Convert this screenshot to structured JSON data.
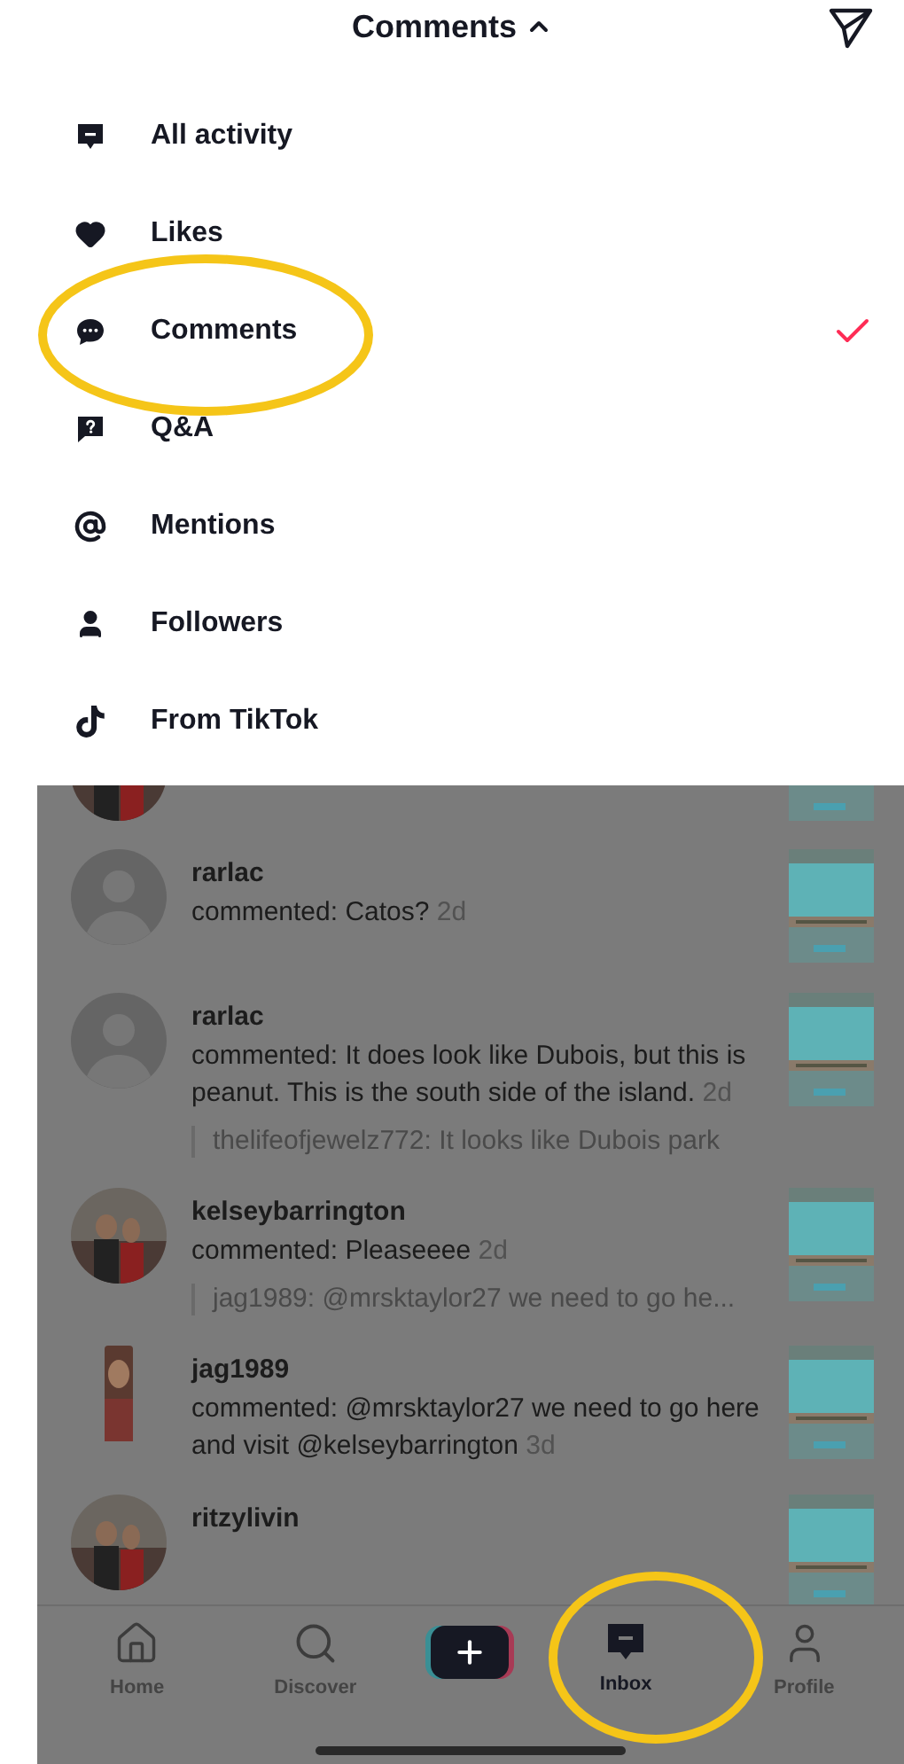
{
  "header": {
    "title": "Comments",
    "expanded": true
  },
  "menu": [
    {
      "kind": "activity",
      "label": "All activity",
      "selected": false
    },
    {
      "kind": "likes",
      "label": "Likes",
      "selected": false
    },
    {
      "kind": "comments",
      "label": "Comments",
      "selected": true
    },
    {
      "kind": "qa",
      "label": "Q&A",
      "selected": false
    },
    {
      "kind": "mentions",
      "label": "Mentions",
      "selected": false
    },
    {
      "kind": "followers",
      "label": "Followers",
      "selected": false
    },
    {
      "kind": "tiktok",
      "label": "From TikTok",
      "selected": false
    }
  ],
  "notifications": [
    {
      "username": "rarlac",
      "avatar": {
        "kind": "default"
      },
      "comment": "commented: Catos?",
      "time": "2d"
    },
    {
      "username": "rarlac",
      "avatar": {
        "kind": "default"
      },
      "comment": "commented: It does look like Dubois, but this is peanut. This is the south side of the island.",
      "time": "2d",
      "quote": "thelifeofjewelz772: It looks like Dubois park"
    },
    {
      "username": "kelseybarrington",
      "comment": "commented: Pleaseeee",
      "time": "2d",
      "quote": "jag1989: @mrsktaylor27 we need to go he..."
    },
    {
      "username": "jag1989",
      "avatar": {
        "kind": "portrait"
      },
      "comment": "commented: @mrsktaylor27 we need to go here and visit @kelseybarrington",
      "time": "3d"
    },
    {
      "username": "ritzylivin"
    }
  ],
  "tabs": [
    {
      "kind": "home",
      "label": "Home",
      "selected": false
    },
    {
      "kind": "discover",
      "label": "Discover",
      "selected": false
    },
    {
      "kind": "create"
    },
    {
      "kind": "inbox",
      "label": "Inbox",
      "selected": true
    },
    {
      "kind": "profile",
      "label": "Profile",
      "selected": false
    }
  ]
}
